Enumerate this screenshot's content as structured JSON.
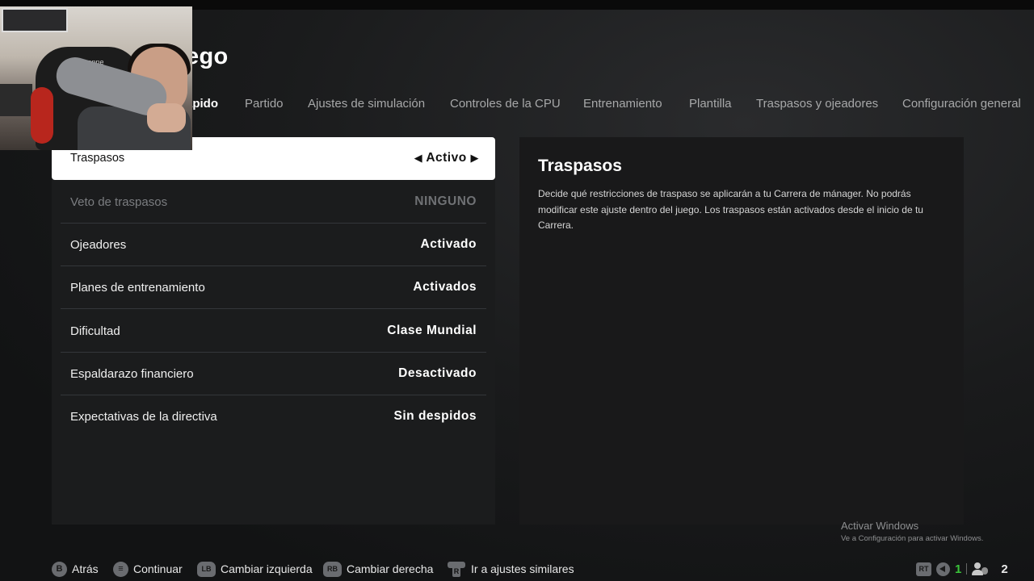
{
  "page": {
    "title": "uego"
  },
  "tabs": [
    {
      "label": "ápido",
      "active": true
    },
    {
      "label": "Partido",
      "active": false
    },
    {
      "label": "Ajustes de simulación",
      "active": false
    },
    {
      "label": "Controles de la CPU",
      "active": false
    },
    {
      "label": "Entrenamiento",
      "active": false
    },
    {
      "label": "Plantilla",
      "active": false
    },
    {
      "label": "Traspasos y ojeadores",
      "active": false
    },
    {
      "label": "Configuración general",
      "active": false
    }
  ],
  "settings": [
    {
      "label": "Traspasos",
      "value": "Activo",
      "selected": true,
      "disabled": false
    },
    {
      "label": "Veto de traspasos",
      "value": "NINGUNO",
      "selected": false,
      "disabled": true
    },
    {
      "label": "Ojeadores",
      "value": "Activado",
      "selected": false,
      "disabled": false
    },
    {
      "label": "Planes de entrenamiento",
      "value": "Activados",
      "selected": false,
      "disabled": false
    },
    {
      "label": "Dificultad",
      "value": "Clase Mundial",
      "selected": false,
      "disabled": false
    },
    {
      "label": "Espaldarazo financiero",
      "value": "Desactivado",
      "selected": false,
      "disabled": false
    },
    {
      "label": "Expectativas de la directiva",
      "value": "Sin despidos",
      "selected": false,
      "disabled": false
    }
  ],
  "selector_arrows": {
    "left": "◀",
    "right": "▶"
  },
  "detail": {
    "title": "Traspasos",
    "text": "Decide qué restricciones de traspaso se aplicarán a tu Carrera de mánager. No podrás modificar este ajuste dentro del juego. Los traspasos están activados desde el inicio de tu Carrera."
  },
  "webcam": {
    "chair_label": "vonne"
  },
  "watermark": {
    "title": "Activar Windows",
    "subtitle": "Ve a Configuración para activar Windows."
  },
  "footer_hints": [
    {
      "glyph": "B",
      "label": "Atrás",
      "icon": "b-button-icon"
    },
    {
      "glyph": "≡",
      "label": "Continuar",
      "icon": "menu-button-icon"
    },
    {
      "glyph": "LB",
      "label": "Cambiar izquierda",
      "icon": "lb-bumper-icon"
    },
    {
      "glyph": "RB",
      "label": "Cambiar derecha",
      "icon": "rb-bumper-icon"
    },
    {
      "glyph": "R",
      "label": "Ir a ajustes similares",
      "icon": "right-stick-icon"
    }
  ],
  "status": {
    "rt_glyph": "RT",
    "count_green": "1",
    "count_players": "2"
  }
}
